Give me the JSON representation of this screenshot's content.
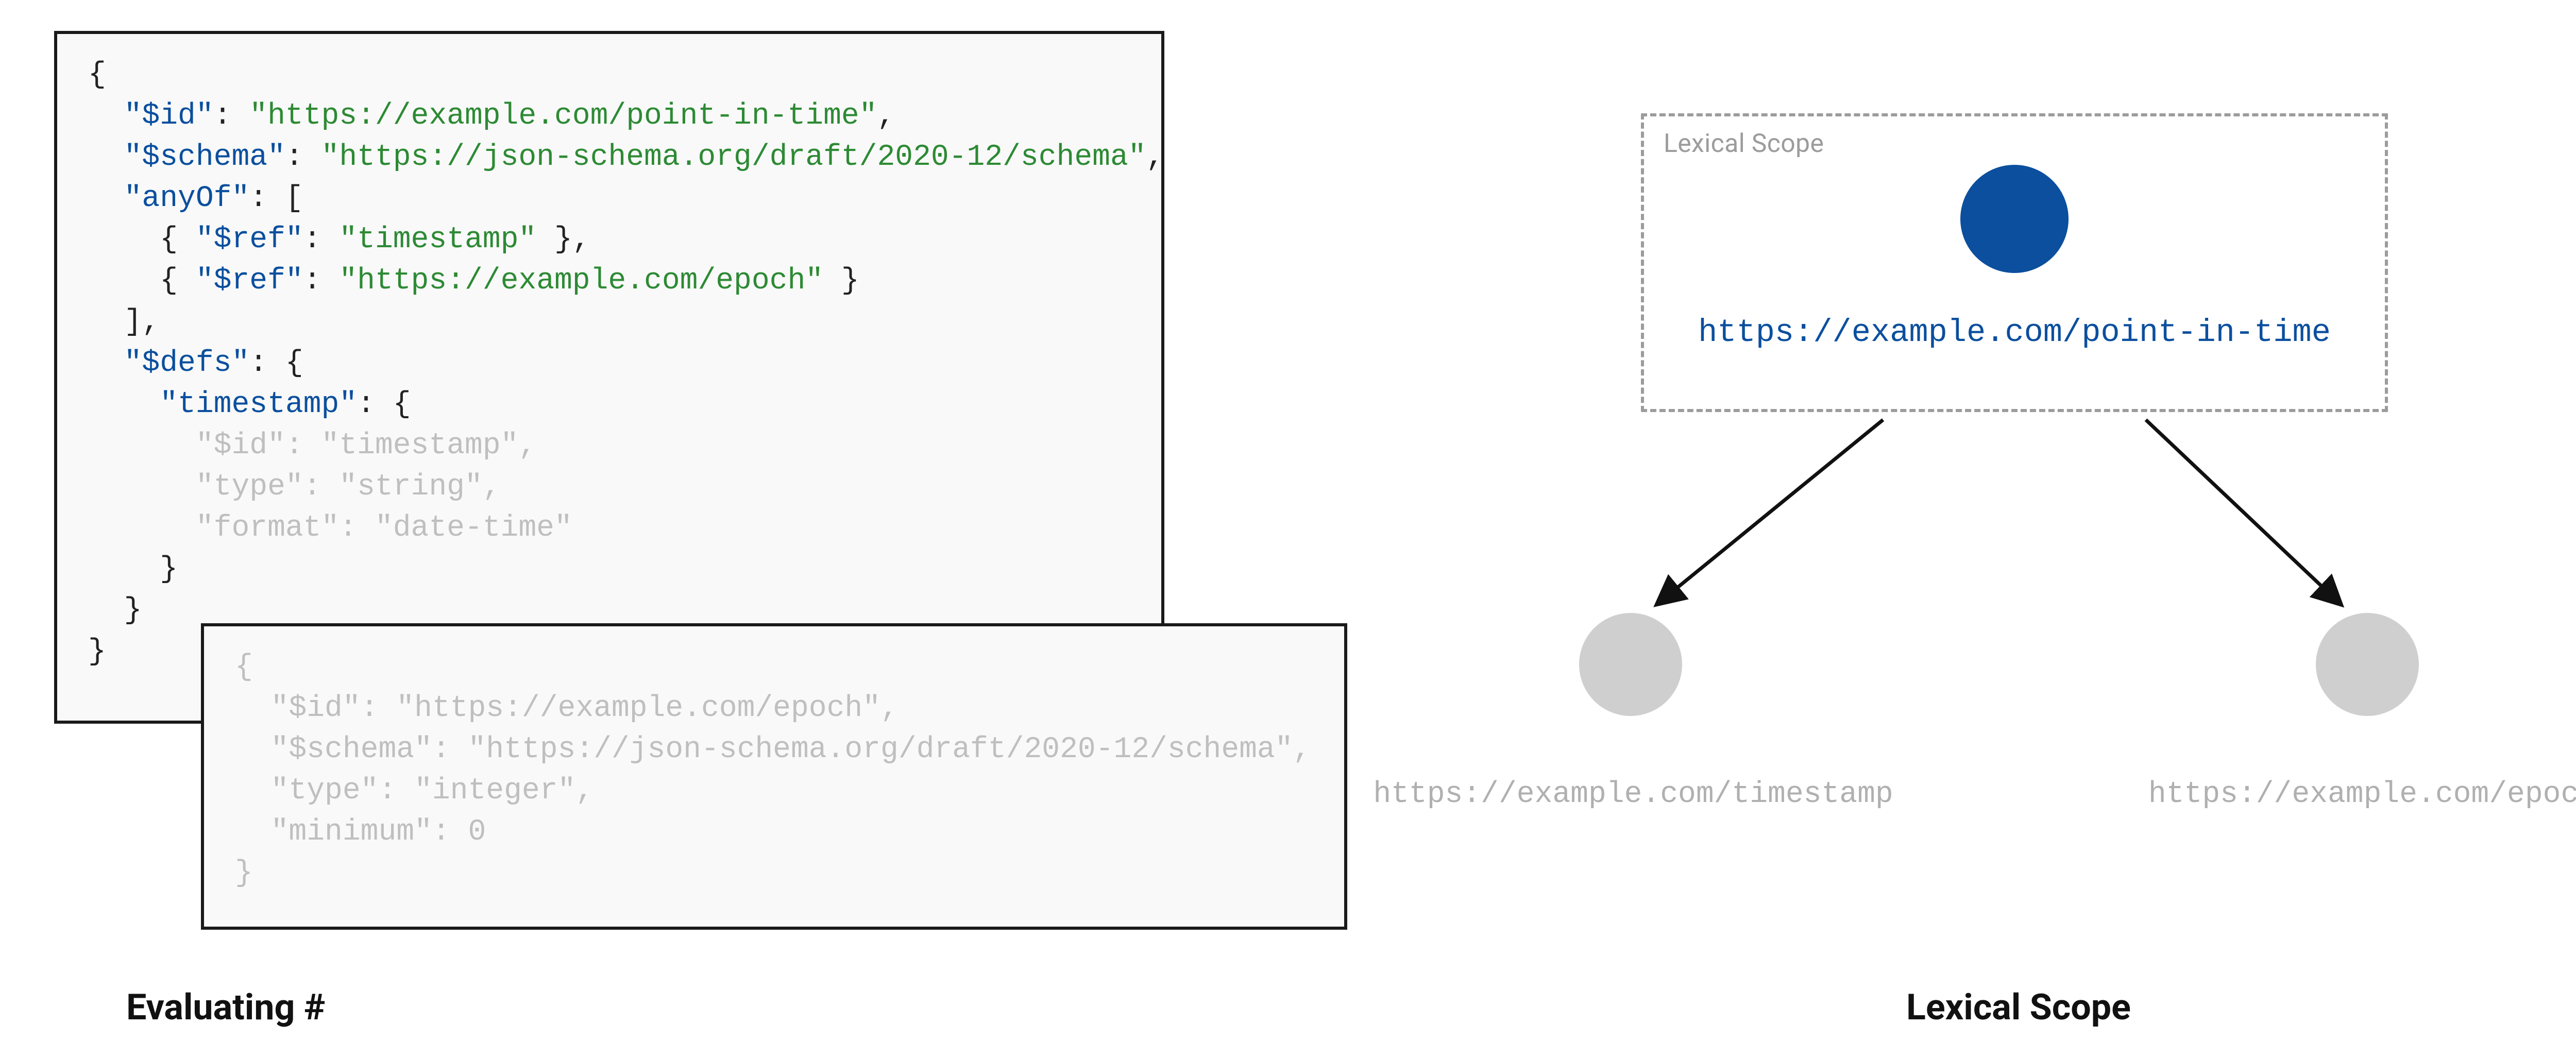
{
  "left_code": {
    "lines": [
      {
        "indent": 0,
        "tokens": [
          {
            "t": "{",
            "c": "p"
          }
        ]
      },
      {
        "indent": 1,
        "tokens": [
          {
            "t": "\"$id\"",
            "c": "k"
          },
          {
            "t": ": ",
            "c": "p"
          },
          {
            "t": "\"https://example.com/point-in-time\"",
            "c": "s"
          },
          {
            "t": ",",
            "c": "p"
          }
        ]
      },
      {
        "indent": 1,
        "tokens": [
          {
            "t": "\"$schema\"",
            "c": "k"
          },
          {
            "t": ": ",
            "c": "p"
          },
          {
            "t": "\"https://json-schema.org/draft/2020-12/schema\"",
            "c": "s"
          },
          {
            "t": ",",
            "c": "p"
          }
        ]
      },
      {
        "indent": 1,
        "tokens": [
          {
            "t": "\"anyOf\"",
            "c": "k"
          },
          {
            "t": ": [",
            "c": "p"
          }
        ]
      },
      {
        "indent": 2,
        "tokens": [
          {
            "t": "{ ",
            "c": "p"
          },
          {
            "t": "\"$ref\"",
            "c": "k"
          },
          {
            "t": ": ",
            "c": "p"
          },
          {
            "t": "\"timestamp\"",
            "c": "s"
          },
          {
            "t": " },",
            "c": "p"
          }
        ]
      },
      {
        "indent": 2,
        "tokens": [
          {
            "t": "{ ",
            "c": "p"
          },
          {
            "t": "\"$ref\"",
            "c": "k"
          },
          {
            "t": ": ",
            "c": "p"
          },
          {
            "t": "\"https://example.com/epoch\"",
            "c": "s"
          },
          {
            "t": " }",
            "c": "p"
          }
        ]
      },
      {
        "indent": 1,
        "tokens": [
          {
            "t": "],",
            "c": "p"
          }
        ]
      },
      {
        "indent": 1,
        "tokens": [
          {
            "t": "\"$defs\"",
            "c": "k"
          },
          {
            "t": ": {",
            "c": "p"
          }
        ]
      },
      {
        "indent": 2,
        "tokens": [
          {
            "t": "\"timestamp\"",
            "c": "k"
          },
          {
            "t": ": {",
            "c": "p"
          }
        ]
      },
      {
        "indent": 3,
        "tokens": [
          {
            "t": "\"$id\": \"timestamp\",",
            "c": "m"
          }
        ]
      },
      {
        "indent": 3,
        "tokens": [
          {
            "t": "\"type\": \"string\",",
            "c": "m"
          }
        ]
      },
      {
        "indent": 3,
        "tokens": [
          {
            "t": "\"format\": \"date-time\"",
            "c": "m"
          }
        ]
      },
      {
        "indent": 2,
        "tokens": [
          {
            "t": "}",
            "c": "p"
          }
        ]
      },
      {
        "indent": 1,
        "tokens": [
          {
            "t": "}",
            "c": "p"
          }
        ]
      },
      {
        "indent": 0,
        "tokens": [
          {
            "t": "}",
            "c": "p"
          }
        ]
      }
    ]
  },
  "right_code": {
    "lines": [
      {
        "indent": 0,
        "tokens": [
          {
            "t": "{",
            "c": "m"
          }
        ]
      },
      {
        "indent": 1,
        "tokens": [
          {
            "t": "\"$id\": \"https://example.com/epoch\",",
            "c": "m"
          }
        ]
      },
      {
        "indent": 1,
        "tokens": [
          {
            "t": "\"$schema\": \"https://json-schema.org/draft/2020-12/schema\",",
            "c": "m"
          }
        ]
      },
      {
        "indent": 1,
        "tokens": [
          {
            "t": "\"type\": \"integer\",",
            "c": "m"
          }
        ]
      },
      {
        "indent": 1,
        "tokens": [
          {
            "t": "\"minimum\": 0",
            "c": "m"
          }
        ]
      },
      {
        "indent": 0,
        "tokens": [
          {
            "t": "}",
            "c": "m"
          }
        ]
      }
    ]
  },
  "diagram": {
    "scope_label": "Lexical Scope",
    "root_url": "https://example.com/point-in-time",
    "child_left_url": "https://example.com/timestamp",
    "child_right_url": "https://example.com/epoch",
    "colors": {
      "primary_node": "#0b4f9e",
      "secondary_node": "#cfcfcf",
      "dashed_border": "#9c9c9c"
    }
  },
  "captions": {
    "left": "Evaluating #",
    "right": "Lexical Scope"
  }
}
